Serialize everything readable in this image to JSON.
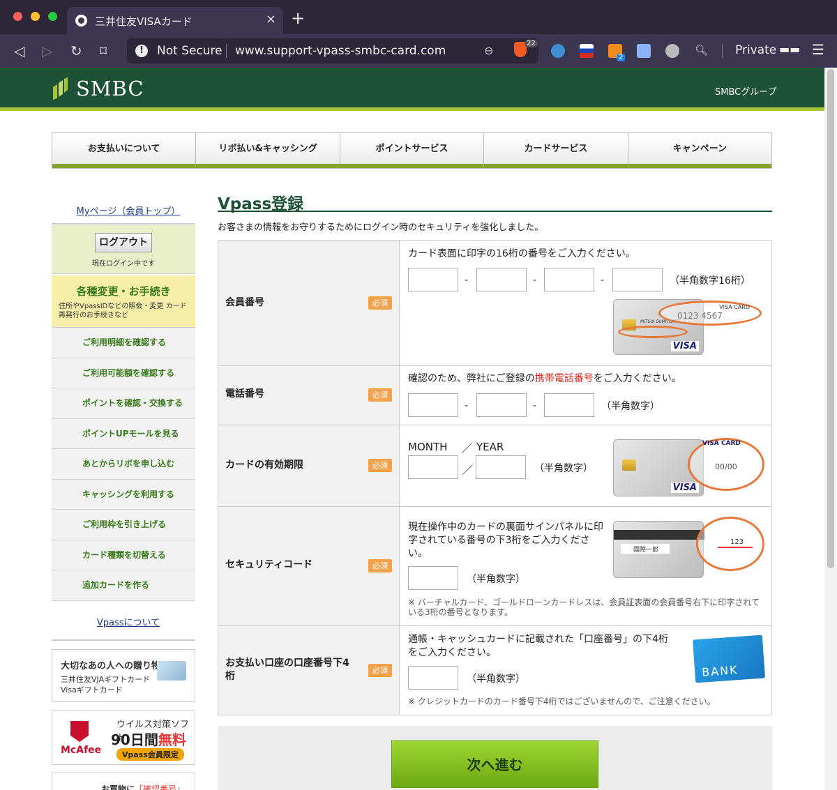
{
  "browser": {
    "tab_title": "三井住友VISAカード",
    "tab_close": "×",
    "new_tab": "+",
    "not_secure": "Not Secure",
    "url": "www.support-vpass-smbc-card.com",
    "brave_count": "22",
    "ext_badge": "2",
    "private_label": "Private"
  },
  "header": {
    "logo": "SMBC",
    "group": "SMBCグループ"
  },
  "global_nav": [
    "お支払いについて",
    "リボ払い&キャッシング",
    "ポイントサービス",
    "カードサービス",
    "キャンペーン"
  ],
  "sidebar": {
    "mypage_link": "Myページ（会員トップ）",
    "logout_button": "ログアウト",
    "logged_in_status": "現在ログイン中です",
    "procedures_title": "各種変更・お手続き",
    "procedures_desc": "住所やVpassIDなどの照会・変更 カード再発行のお手続きなど",
    "menu": [
      "ご利用明細を確認する",
      "ご利用可能額を確認する",
      "ポイントを確認・交換する",
      "ポイントUPモールを見る",
      "あとからリボを申し込む",
      "キャッシングを利用する",
      "ご利用枠を引き上げる",
      "カード種類を切替える",
      "追加カードを作る"
    ],
    "vpass_link": "Vpassについて",
    "banner_gift": {
      "title": "大切なあの人への贈り物",
      "line1": "三井住友VJAギフトカード",
      "line2": "Visaギフトカード"
    },
    "banner_mcafee": {
      "brand": "McAfee",
      "line1": "ウイルス対策ソフト",
      "days": "90日間",
      "free": "無料",
      "tag": "Vpass会員限定"
    },
    "banner_bottom": {
      "text": "お買物に",
      "highlight": "「確認番号」"
    }
  },
  "form": {
    "title": "Vpass登録",
    "intro": "お客さまの情報をお守りするためにログイン時のセキュリティを強化しました。",
    "required_label": "必須",
    "card_number": {
      "label": "会員番号",
      "desc": "カード表面に印字の16桁の番号をご入力ください。",
      "hint": "（半角数字16桁）",
      "img_label": "VISA CARD",
      "img_issuer": "MITSUI SUMITOMO",
      "img_number": "0123 4567",
      "img_brand": "VISA"
    },
    "phone": {
      "label": "電話番号",
      "desc_pre": "確認のため、弊社にご登録の",
      "desc_red": "携帯電話番号",
      "desc_post": "をご入力ください。",
      "hint": "（半角数字）"
    },
    "expiry": {
      "label": "カードの有効期限",
      "month": "MONTH",
      "slash": "／",
      "year": "YEAR",
      "hint": "（半角数字）",
      "img_label": "VISA CARD",
      "img_date": "00/00",
      "img_brand": "VISA"
    },
    "cvv": {
      "label": "セキュリティコード",
      "desc": "現在操作中のカードの裏面サインパネルに印字されている番号の下3桁をご入力ください。",
      "hint": "（半角数字）",
      "note": "※ バーチャルカード、ゴールドローンカードレスは、会員証表面の会員番号右下に印字されている3桁の番号となります。",
      "img_code": "123",
      "img_signature": "國際一郎"
    },
    "bank": {
      "label": "お支払い口座の口座番号下4桁",
      "desc": "通帳・キャッシュカードに記載された「口座番号」の下4桁をご入力ください。",
      "hint": "（半角数字）",
      "note": "※ クレジットカードのカード番号下4桁ではございませんので、ご注意ください。",
      "img_word": "BANK"
    },
    "next_button": "次へ進む"
  }
}
